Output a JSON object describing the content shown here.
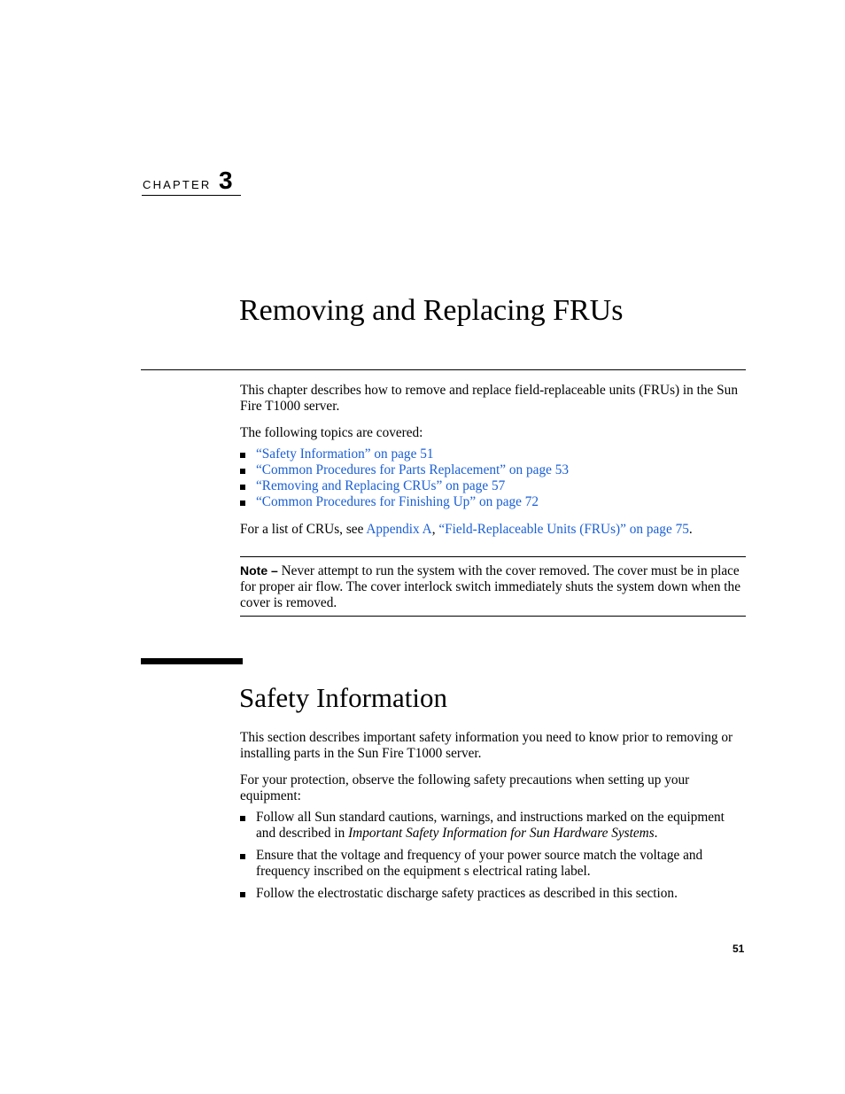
{
  "chapter": {
    "label": "CHAPTER",
    "number": "3"
  },
  "title": "Removing and Replacing FRUs",
  "intro": {
    "paragraph": "This chapter describes how to remove and replace field-replaceable units (FRUs) in the Sun Fire T1000 server.",
    "topics_lead": "The following topics are covered:",
    "topics": [
      {
        "label": "“Safety Information” on page 51"
      },
      {
        "label": "“Common Procedures for Parts Replacement” on page 53"
      },
      {
        "label": "“Removing and Replacing CRUs” on page 57"
      },
      {
        "label": "“Common Procedures for Finishing Up” on page 72"
      }
    ],
    "cru_list": {
      "prefix": "For a list of CRUs, see ",
      "link1": "Appendix A",
      "separator": ", ",
      "link2": "“Field-Replaceable Units (FRUs)” on page 75",
      "suffix": "."
    }
  },
  "note": {
    "label": "Note –",
    "text": " Never attempt to run the system with the cover removed. The cover must be in place for proper air flow. The cover interlock switch immediately shuts the system down when the cover is removed."
  },
  "safety_section": {
    "heading": "Safety Information",
    "paragraph1": "This section describes important safety information you need to know prior to removing or installing parts in the Sun Fire T1000 server.",
    "paragraph2": "For your protection, observe the following safety precautions when setting up your equipment:",
    "items": [
      {
        "text": "Follow all Sun standard cautions, warnings, and instructions marked on the equipment and described in ",
        "italic": "Important Safety Information for Sun Hardware Systems",
        "suffix": "."
      },
      {
        "text": "Ensure that the voltage and frequency of your power source match the voltage and frequency inscribed on the equipment s electrical rating label."
      },
      {
        "text": "Follow the electrostatic discharge safety practices as described in this section."
      }
    ]
  },
  "page_number": "51",
  "colors": {
    "link": "#1a5fd6",
    "text": "#000000"
  }
}
